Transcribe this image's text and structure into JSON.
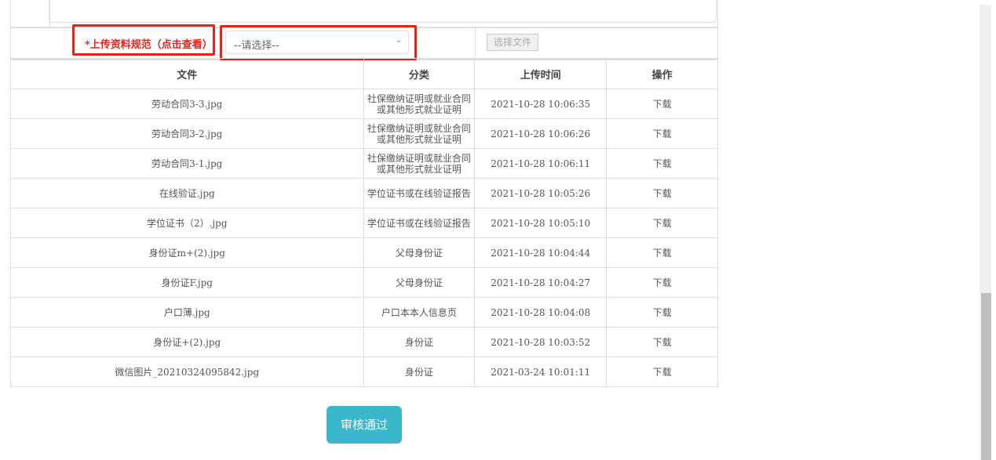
{
  "upload": {
    "label": "*上传资料规范（点击查看）",
    "select_placeholder": "--请选择--",
    "file_button": "选择文件"
  },
  "table": {
    "headers": [
      "文件",
      "分类",
      "上传时间",
      "操作"
    ],
    "rows": [
      {
        "file": "劳动合同3-3.jpg",
        "category": "社保缴纳证明或就业合同或其他形式就业证明",
        "time": "2021-10-28 10:06:35",
        "action": "下载"
      },
      {
        "file": "劳动合同3-2.jpg",
        "category": "社保缴纳证明或就业合同或其他形式就业证明",
        "time": "2021-10-28 10:06:26",
        "action": "下载"
      },
      {
        "file": "劳动合同3-1.jpg",
        "category": "社保缴纳证明或就业合同或其他形式就业证明",
        "time": "2021-10-28 10:06:11",
        "action": "下载"
      },
      {
        "file": "在线验证.jpg",
        "category": "学位证书或在线验证报告",
        "time": "2021-10-28 10:05:26",
        "action": "下载"
      },
      {
        "file": "学位证书（2）.jpg",
        "category": "学位证书或在线验证报告",
        "time": "2021-10-28 10:05:10",
        "action": "下载"
      },
      {
        "file": "身份证m+(2).jpg",
        "category": "父母身份证",
        "time": "2021-10-28 10:04:44",
        "action": "下载"
      },
      {
        "file": "身份证F.jpg",
        "category": "父母身份证",
        "time": "2021-10-28 10:04:27",
        "action": "下载"
      },
      {
        "file": "户口薄.jpg",
        "category": "户口本本人信息页",
        "time": "2021-10-28 10:04:08",
        "action": "下载"
      },
      {
        "file": "身份证+(2).jpg",
        "category": "身份证",
        "time": "2021-10-28 10:03:52",
        "action": "下载"
      },
      {
        "file": "微信图片_20210324095842.jpg",
        "category": "身份证",
        "time": "2021-03-24 10:01:11",
        "action": "下载"
      }
    ]
  },
  "approve_label": "审核通过",
  "colors": {
    "accent": "#3bb7cc",
    "highlight": "#e5221c"
  }
}
